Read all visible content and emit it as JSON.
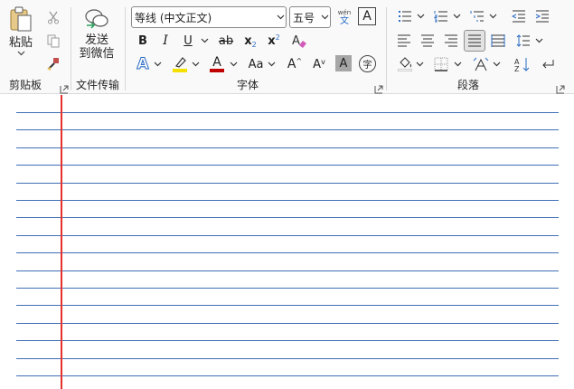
{
  "clipboard": {
    "paste_label": "粘贴",
    "group_label": "剪贴板"
  },
  "file_transfer": {
    "send_label_line1": "发送",
    "send_label_line2": "到微信",
    "group_label": "文件传输"
  },
  "font": {
    "font_name": "等线 (中文正文)",
    "font_size": "五号",
    "phonetic_top": "wén",
    "phonetic_bottom": "文",
    "border_char": "A",
    "bold": "B",
    "italic": "I",
    "underline": "U",
    "strike": "ab",
    "subscript_base": "x",
    "subscript_sub": "2",
    "superscript_base": "x",
    "superscript_sup": "2",
    "text_effect": "A",
    "font_color": "A",
    "change_case": "Aa",
    "grow": "A",
    "shrink": "A",
    "shade": "A",
    "enclose": "字",
    "group_label": "字体"
  },
  "paragraph": {
    "group_label": "段落"
  },
  "colors": {
    "highlight": "#f5e100",
    "font_color_bar": "#c00000",
    "margin_line": "#e5302b",
    "rule_line": "#3f6fb6"
  },
  "document": {
    "ruled_line_count": 16
  }
}
